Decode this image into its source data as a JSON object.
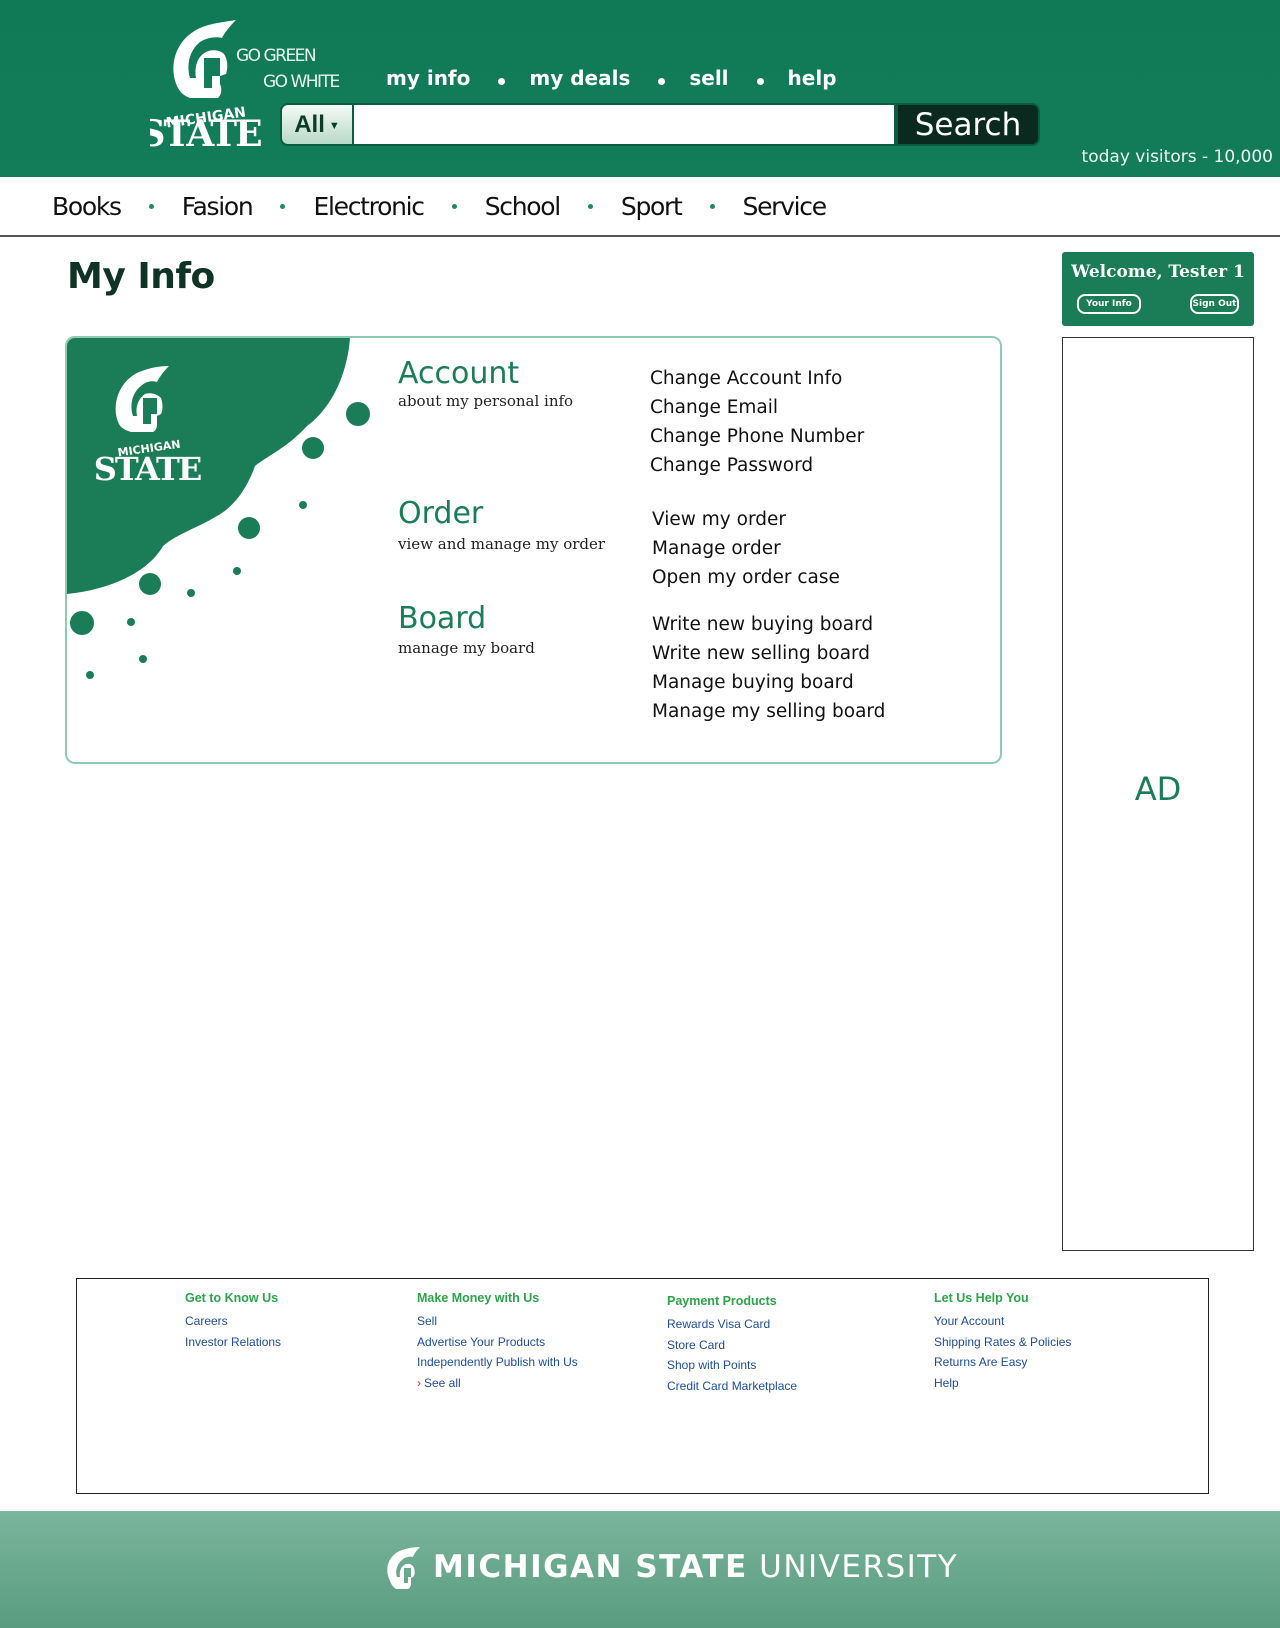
{
  "header": {
    "slogan_line1": "GO GREEN",
    "slogan_line2": "GO WHITE",
    "logo_text": "MICHIGAN STATE",
    "nav": [
      "my info",
      "my deals",
      "sell",
      "help"
    ],
    "search": {
      "category": "All",
      "button": "Search",
      "value": ""
    },
    "visitors": "today visitors - 10,000"
  },
  "categories": [
    "Books",
    "Fasion",
    "Electronic",
    "School",
    "Sport",
    "Service"
  ],
  "main": {
    "title": "My Info",
    "sections": [
      {
        "title": "Account",
        "subtitle": "about my personal info",
        "links": [
          "Change Account Info",
          "Change Email",
          "Change Phone Number",
          "Change Password"
        ]
      },
      {
        "title": "Order",
        "subtitle": "view and manage my order",
        "links": [
          "View my order",
          "Manage order",
          "Open my order case"
        ]
      },
      {
        "title": "Board",
        "subtitle": "manage my board",
        "links": [
          "Write new buying board",
          "Write new selling board",
          "Manage buying board",
          "Manage my selling board"
        ]
      }
    ]
  },
  "sidebar": {
    "welcome": "Welcome, Tester 1",
    "your_info": "Your Info",
    "sign_out": "Sign Out",
    "ad": "AD"
  },
  "footer": {
    "columns": [
      {
        "title": "Get to Know Us",
        "links": [
          "Careers",
          "Investor Relations"
        ]
      },
      {
        "title": "Make Money with Us",
        "links": [
          "Sell",
          "Advertise Your Products",
          "Independently Publish with Us",
          "See all"
        ]
      },
      {
        "title": "Payment Products",
        "links": [
          "Rewards Visa Card",
          "Store Card",
          "Shop with Points",
          "Credit Card Marketplace"
        ]
      },
      {
        "title": "Let Us Help You",
        "links": [
          "Your Account",
          "Shipping Rates & Policies",
          "Returns Are Easy",
          "Help"
        ]
      }
    ],
    "brand_bold": "MICHIGAN STATE",
    "brand_light": "UNIVERSITY"
  },
  "colors": {
    "header_green": "#137d59",
    "accent_green": "#1a7d57",
    "footer_title_green": "#2aa54a",
    "footer_link_blue": "#1c4d9c"
  },
  "icons": [
    "spartan-helmet-icon",
    "dropdown-caret-icon",
    "arrow-right-icon"
  ]
}
